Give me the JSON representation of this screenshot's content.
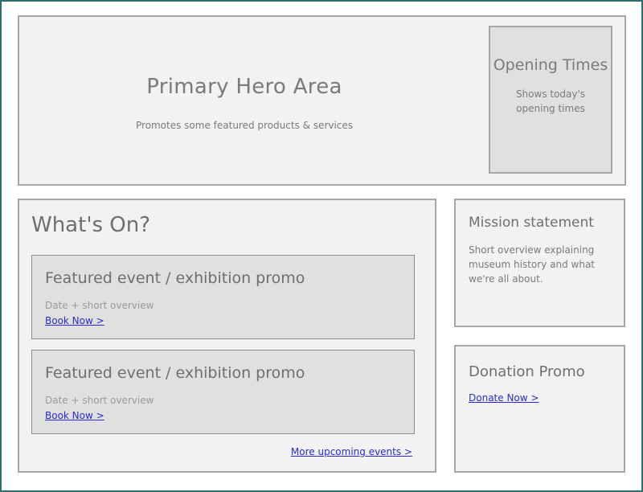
{
  "hero": {
    "title": "Primary Hero Area",
    "subtitle": "Promotes some featured products & services",
    "opening_times": {
      "title": "Opening Times",
      "text": "Shows today's opening times"
    }
  },
  "whats_on": {
    "title": "What's On?",
    "events": [
      {
        "title": "Featured event / exhibition promo",
        "subtitle": "Date + short overview",
        "link": "Book Now >"
      },
      {
        "title": "Featured event / exhibition promo",
        "subtitle": "Date + short overview",
        "link": "Book Now >"
      }
    ],
    "more_link": "More upcoming events >"
  },
  "mission": {
    "title": "Mission statement",
    "text": "Short overview explaining museum history and what we're all about."
  },
  "donation": {
    "title": "Donation Promo",
    "link": "Donate Now >"
  },
  "colors": {
    "panel_bg": "#f2f2f2",
    "inner_bg": "#e0e0e0",
    "border": "#a6a6a6",
    "link": "#2a2acc",
    "frame": "#2f6f6f"
  }
}
